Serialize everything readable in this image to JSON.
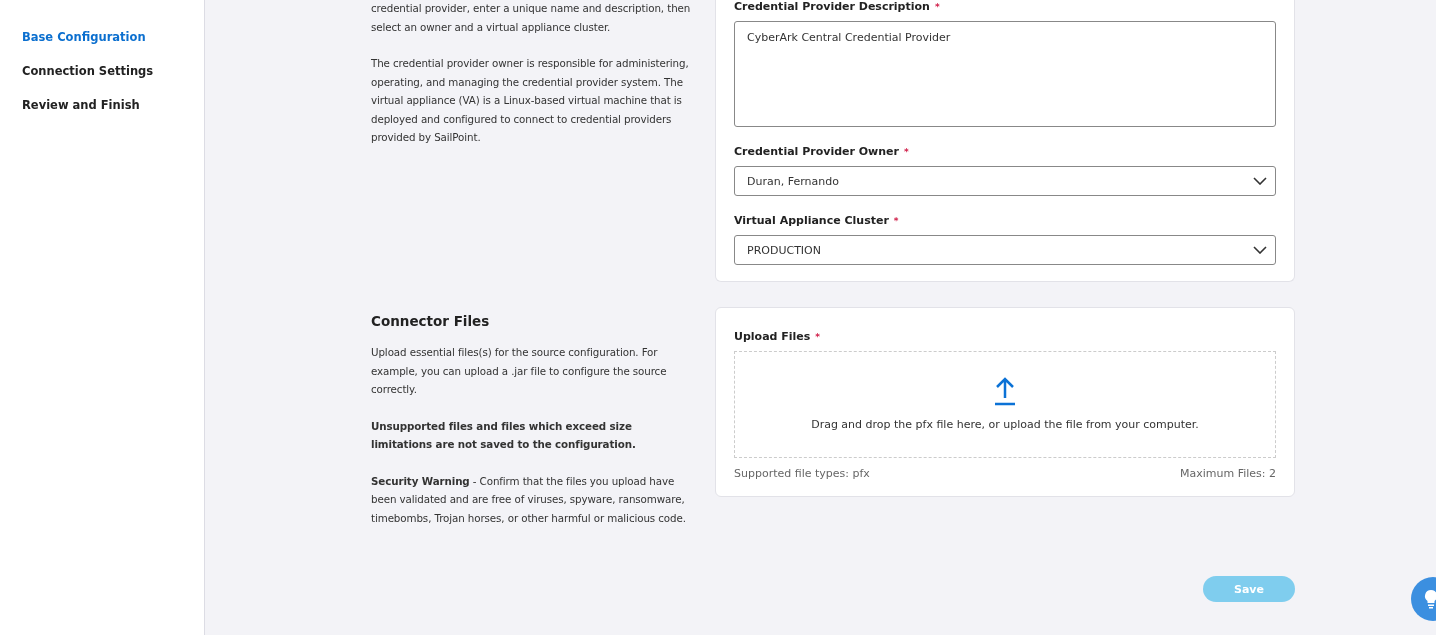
{
  "sidebar": {
    "items": [
      {
        "label": "Base Configuration",
        "selected": true
      },
      {
        "label": "Connection Settings",
        "selected": false
      },
      {
        "label": "Review and Finish",
        "selected": false
      }
    ]
  },
  "sections": [
    {
      "paragraphs": [
        "credential provider, enter a unique name and description, then select an owner and a virtual appliance cluster.",
        "The credential provider owner is responsible for administering, operating, and managing the credential provider system. The virtual appliance (VA) is a Linux-based virtual machine that is deployed and configured to connect to credential providers provided by SailPoint."
      ],
      "fields": [
        {
          "kind": "textarea",
          "label": "Credential Provider Description",
          "required_mark": "*",
          "value": "CyberArk Central Credential Provider"
        },
        {
          "kind": "select",
          "label": "Credential Provider Owner",
          "required_mark": "*",
          "value": "Duran, Fernando"
        },
        {
          "kind": "select",
          "label": "Virtual Appliance Cluster",
          "required_mark": "*",
          "value": "PRODUCTION"
        }
      ]
    },
    {
      "heading": "Connector Files",
      "paragraphs": [
        "Upload essential files(s) for the source configuration. For example, you can upload a .jar file to configure the source correctly.",
        "**Unsupported files and files which exceed size limitations are not saved to the configuration.**",
        "**Security Warning** - Confirm that the files you upload have been validated and are free of viruses, spyware, ransomware, timebombs, Trojan horses, or other harmful or malicious code."
      ],
      "fields": [
        {
          "kind": "upload",
          "label": "Upload Files",
          "required_mark": "*",
          "prompt": "Drag and drop the pfx file here, or upload the file from your computer.",
          "supported": "Supported file types: pfx",
          "maximum": "Maximum Files: 2"
        }
      ]
    }
  ],
  "save_button": {
    "label": "Save",
    "disabled": true
  }
}
